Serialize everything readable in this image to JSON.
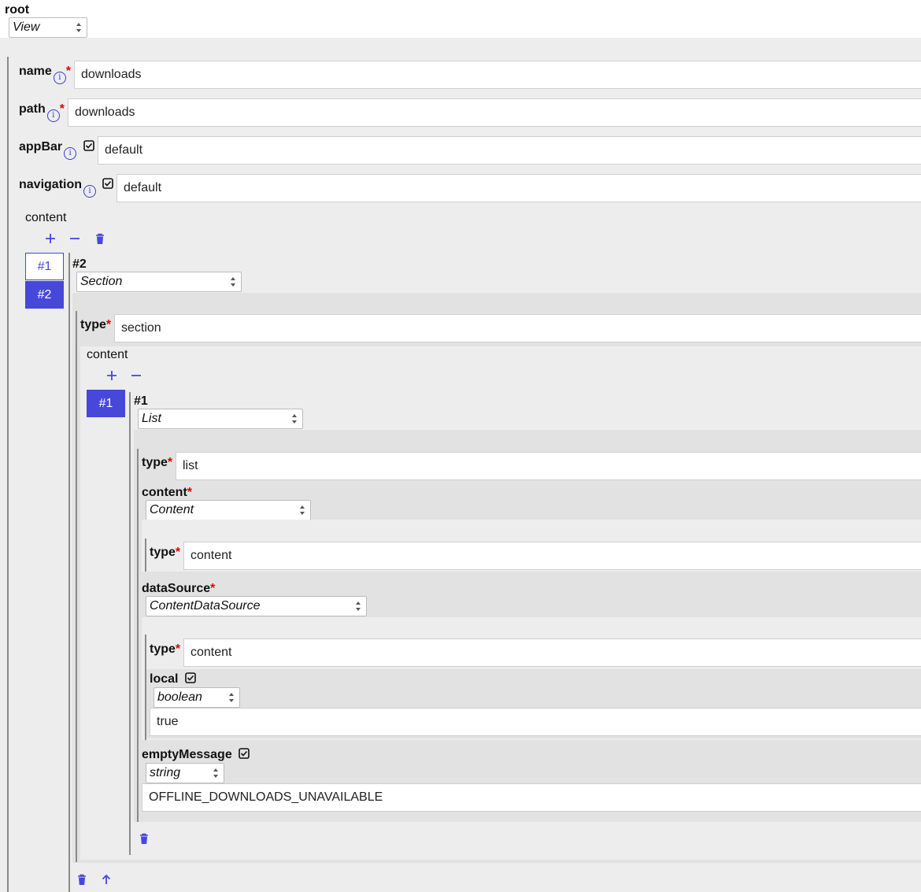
{
  "root": {
    "label": "root",
    "type_select": "View"
  },
  "fields": {
    "name": {
      "label": "name",
      "value": "downloads"
    },
    "path": {
      "label": "path",
      "value": "downloads"
    },
    "appBar": {
      "label": "appBar",
      "value": "default"
    },
    "navigation": {
      "label": "navigation",
      "value": "default"
    }
  },
  "content": {
    "label": "content",
    "tabs": [
      "#1",
      "#2"
    ],
    "active_tab": "#2",
    "item": {
      "title": "#2",
      "type_select": "Section",
      "type_label": "type",
      "type_value": "section",
      "content_label": "content",
      "tabs": [
        "#1"
      ],
      "inner": {
        "title": "#1",
        "type_select": "List",
        "type_label": "type",
        "type_value": "list",
        "content_field": {
          "label": "content",
          "select": "Content",
          "type_label": "type",
          "type_value": "content"
        },
        "dataSource": {
          "label": "dataSource",
          "select": "ContentDataSource",
          "type_label": "type",
          "type_value": "content",
          "local": {
            "label": "local",
            "select": "boolean",
            "value": "true"
          }
        },
        "emptyMessage": {
          "label": "emptyMessage",
          "select": "string",
          "value": "OFFLINE_DOWNLOADS_UNAVAILABLE"
        }
      }
    }
  },
  "icons": {
    "accent": "#4747d9",
    "required": "#e00000"
  }
}
